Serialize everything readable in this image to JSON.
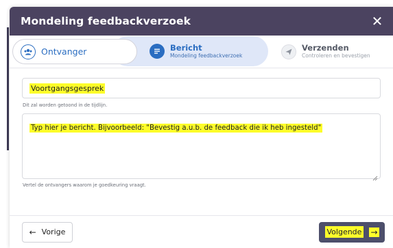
{
  "dialog": {
    "title": "Mondeling feedbackverzoek",
    "close_symbol": "✕"
  },
  "steps": [
    {
      "label": "Ontvanger",
      "sublabel": "",
      "icon": "users-icon",
      "state": "completed"
    },
    {
      "label": "Bericht",
      "sublabel": "Mondeling feedbackverzoek",
      "icon": "message-icon",
      "state": "active"
    },
    {
      "label": "Verzenden",
      "sublabel": "Controleren en bevestigen",
      "icon": "send-icon",
      "state": "upcoming"
    }
  ],
  "form": {
    "title_value": "Voortgangsgesprek",
    "title_hint": "Dit zal worden getoond in de tijdlijn.",
    "message_placeholder": "Typ hier je bericht. Bijvoorbeeld: \"Bevestig a.u.b. de feedback die ik heb ingesteld\"",
    "message_hint": "Vertel de ontvangers waarom je goedkeuring vraagt."
  },
  "footer": {
    "prev_label": "Vorige",
    "prev_arrow": "←",
    "next_label": "Volgende",
    "next_arrow": "→"
  },
  "colors": {
    "header_bg": "#4b4360",
    "accent": "#2a6dc1",
    "active_step_bg": "#dfe7f8",
    "highlight": "#fdfd2a",
    "next_button_bg": "#4d4f6b"
  }
}
